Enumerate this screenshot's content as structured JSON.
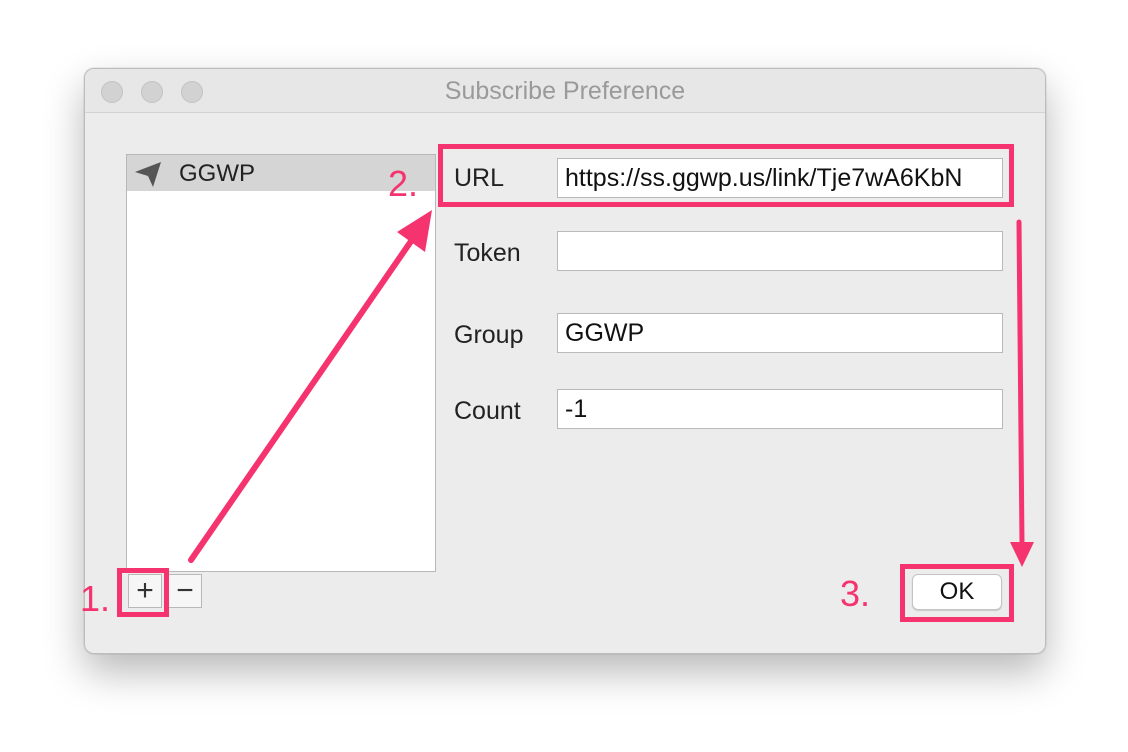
{
  "window": {
    "title": "Subscribe Preference"
  },
  "sidebar": {
    "items": [
      {
        "label": "GGWP",
        "icon": "paper-plane-icon",
        "selected": true
      }
    ],
    "add_label": "+",
    "remove_label": "−"
  },
  "form": {
    "url": {
      "label": "URL",
      "value": "https://ss.ggwp.us/link/Tje7wA6KbN"
    },
    "token": {
      "label": "Token",
      "value": ""
    },
    "group": {
      "label": "Group",
      "value": "GGWP"
    },
    "count": {
      "label": "Count",
      "value": "-1"
    }
  },
  "buttons": {
    "ok_label": "OK"
  },
  "annotations": {
    "step1": "1.",
    "step2": "2.",
    "step3": "3.",
    "color": "#f5336e"
  }
}
